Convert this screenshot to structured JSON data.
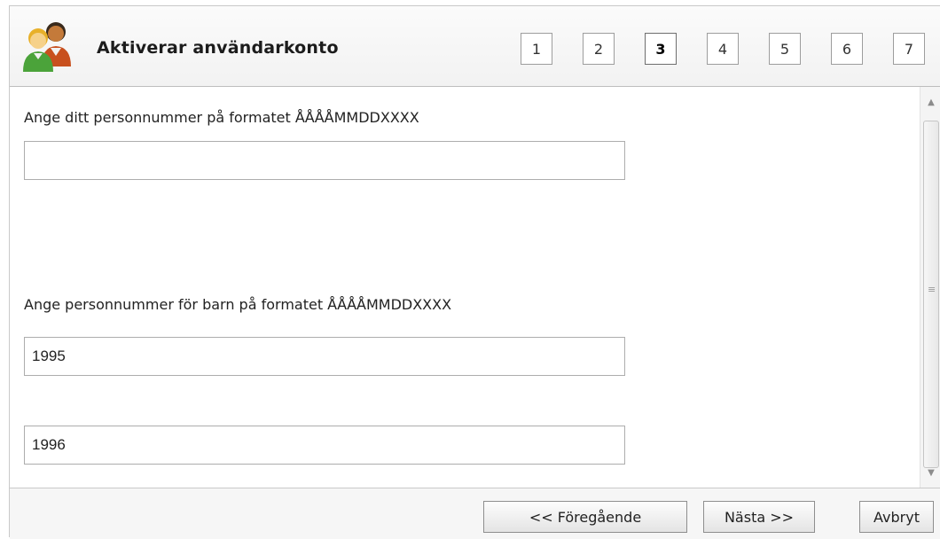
{
  "header": {
    "title": "Aktiverar användarkonto",
    "steps": [
      "1",
      "2",
      "3",
      "4",
      "5",
      "6",
      "7"
    ],
    "active_step": "3"
  },
  "form": {
    "own_label": "Ange ditt personnummer på formatet ÅÅÅÅMMDDXXXX",
    "own_value": "",
    "children_label": "Ange personnummer för barn på formatet ÅÅÅÅMMDDXXXX",
    "child1_value": "1995",
    "child2_value": "1996"
  },
  "footer": {
    "previous_label": "<< Föregående",
    "next_label": "Nästa >>",
    "cancel_label": "Avbryt"
  },
  "icons": {
    "header_icon": "users-icon",
    "scroll_up": "arrow-up-icon",
    "scroll_down": "arrow-down-icon"
  }
}
